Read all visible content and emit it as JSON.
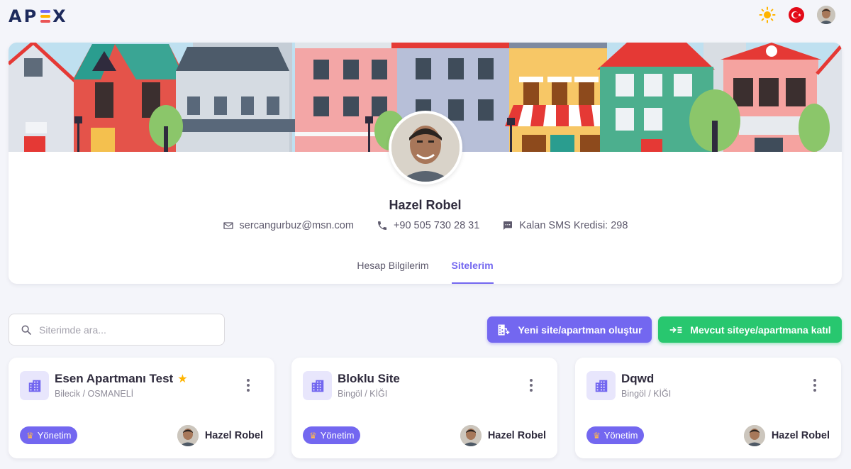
{
  "app": {
    "logo": "APEX"
  },
  "topbar": {
    "theme_icon": "sun-icon",
    "language_icon": "turkey-flag-icon"
  },
  "profile": {
    "name": "Hazel Robel",
    "email": "sercangurbuz@msn.com",
    "phone": "+90 505 730 28 31",
    "sms_credit": "Kalan SMS Kredisi: 298"
  },
  "tabs": [
    {
      "label": "Hesap Bilgilerim",
      "active": false
    },
    {
      "label": "Sitelerim",
      "active": true
    }
  ],
  "search": {
    "placeholder": "Siterimde ara..."
  },
  "actions": {
    "new_site": "Yeni site/apartman oluştur",
    "join_site": "Mevcut siteye/apartmana katıl"
  },
  "sites": [
    {
      "title": "Esen Apartmanı Test",
      "starred": true,
      "location": "Bilecik / OSMANELİ",
      "role": "Yönetim",
      "owner": "Hazel Robel"
    },
    {
      "title": "Bloklu Site",
      "starred": false,
      "location": "Bingöl / KİĞI",
      "role": "Yönetim",
      "owner": "Hazel Robel"
    },
    {
      "title": "Dqwd",
      "starred": false,
      "location": "Bingöl / KİĞI",
      "role": "Yönetim",
      "owner": "Hazel Robel"
    }
  ],
  "colors": {
    "primary": "#7367f0",
    "success": "#28c76f",
    "text": "#2f2b3d",
    "muted": "#5d596c"
  }
}
